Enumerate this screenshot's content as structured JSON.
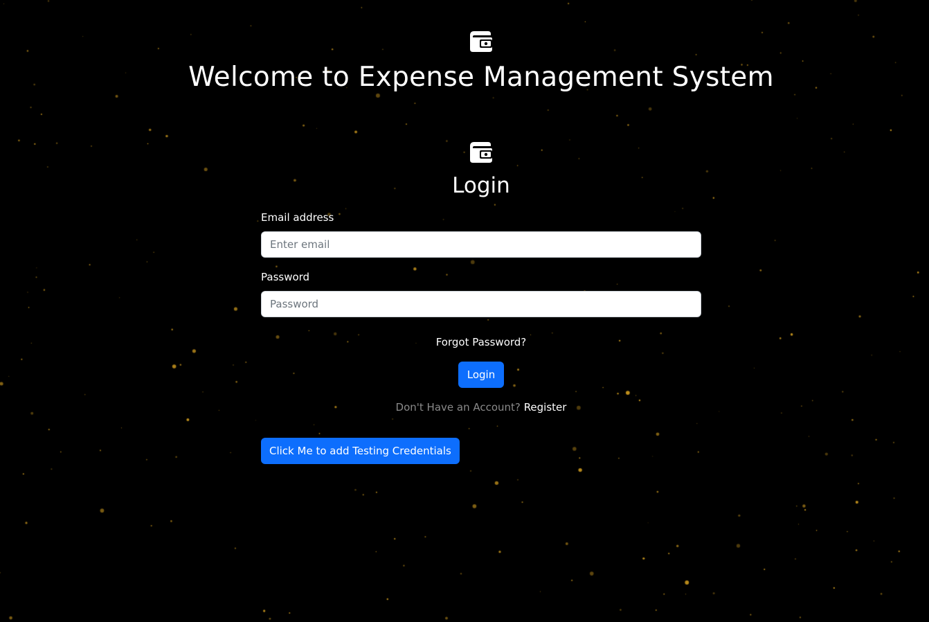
{
  "hero": {
    "icon": "wallet-icon",
    "title": "Welcome to Expense Management System"
  },
  "login": {
    "icon": "wallet-icon",
    "title": "Login",
    "email_label": "Email address",
    "email_placeholder": "Enter email",
    "email_value": "",
    "password_label": "Password",
    "password_placeholder": "Password",
    "password_value": "",
    "forgot_label": "Forgot Password?",
    "submit_label": "Login",
    "no_account_text": "Don't Have an Account?",
    "register_label": "Register",
    "test_credentials_label": "Click Me to add Testing Credentials"
  },
  "colors": {
    "background": "#000000",
    "primary": "#0d6efd",
    "star": "#c8961e",
    "muted_text": "#8a8a8a"
  }
}
